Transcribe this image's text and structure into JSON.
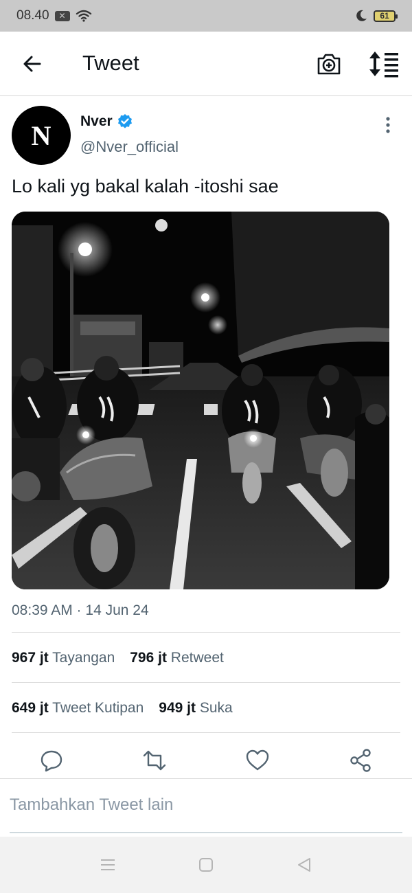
{
  "status_bar": {
    "time": "08.40",
    "notification_badge": "✕",
    "battery": "61",
    "icons": [
      "close-box-icon",
      "wifi-icon",
      "moon-icon",
      "battery-icon"
    ]
  },
  "header": {
    "title": "Tweet",
    "icons": [
      "back-arrow-icon",
      "camera-plus-icon",
      "sort-icon"
    ]
  },
  "tweet": {
    "avatar_letter": "N",
    "display_name": "Nver",
    "verified": true,
    "handle": "@Nver_official",
    "text": "Lo kali yg bakal kalah -itoshi sae",
    "media_description": "black-and-white night street photo of motorcyclists",
    "timestamp": "08:39 AM · 14 Jun 24",
    "stats": [
      {
        "count": "967 jt",
        "label": "Tayangan"
      },
      {
        "count": "796 jt",
        "label": "Retweet"
      },
      {
        "count": "649 jt",
        "label": "Tweet Kutipan"
      },
      {
        "count": "949 jt",
        "label": "Suka"
      }
    ]
  },
  "actions": {
    "icons": [
      "reply-icon",
      "retweet-icon",
      "like-icon",
      "share-icon"
    ]
  },
  "compose": {
    "placeholder": "Tambahkan Tweet lain"
  },
  "nav_bar": {
    "icons": [
      "menu-icon",
      "home-icon",
      "back-icon"
    ]
  },
  "colors": {
    "status_bar_bg": "#c9c9c9",
    "verified_blue": "#1d9bf0",
    "text_primary": "#0f1419",
    "text_secondary": "#536471"
  }
}
